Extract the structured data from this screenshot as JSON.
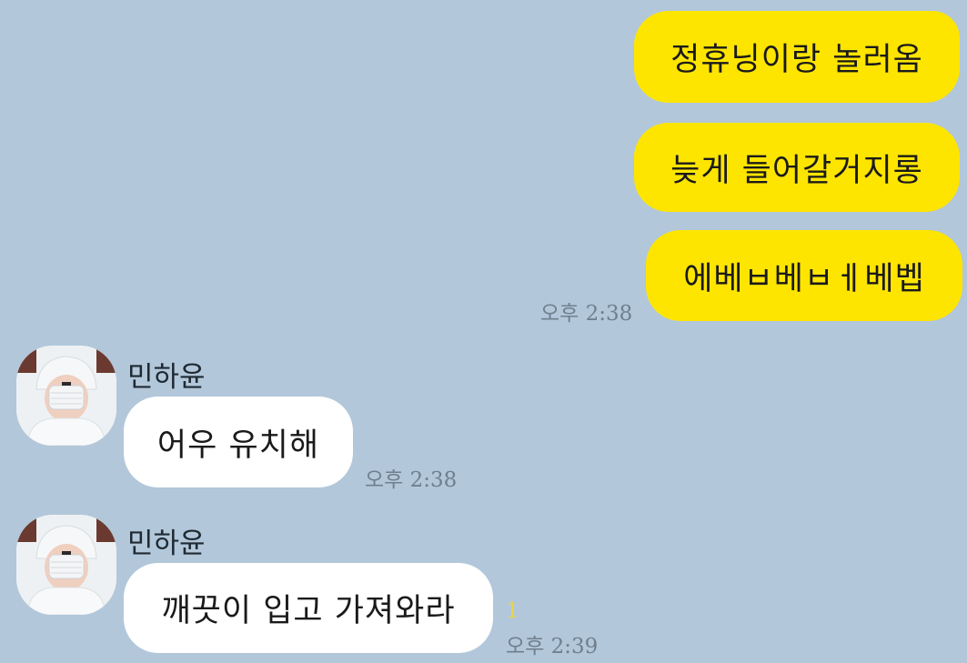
{
  "conversation": {
    "outgoing": [
      {
        "text": "정휴닝이랑 놀러옴"
      },
      {
        "text": "늦게 들어갈거지롱"
      },
      {
        "text": "에베ㅂ베ㅂㅔ베벱",
        "time": "오후 2:38"
      }
    ],
    "incoming": [
      {
        "sender": "민하윤",
        "text": "어우 유치해",
        "time": "오후 2:38",
        "avatar": "profile-photo-masked-person-white-hat"
      },
      {
        "sender": "민하윤",
        "text": "깨끗이 입고 가져와라",
        "time": "오후 2:39",
        "unread": "1",
        "avatar": "profile-photo-masked-person-white-hat"
      }
    ]
  },
  "colors": {
    "background": "#b2c7da",
    "outgoing_bubble": "#fee500",
    "incoming_bubble": "#ffffff",
    "time_text": "#6f7f8d",
    "unread_count": "#e8d44a"
  }
}
